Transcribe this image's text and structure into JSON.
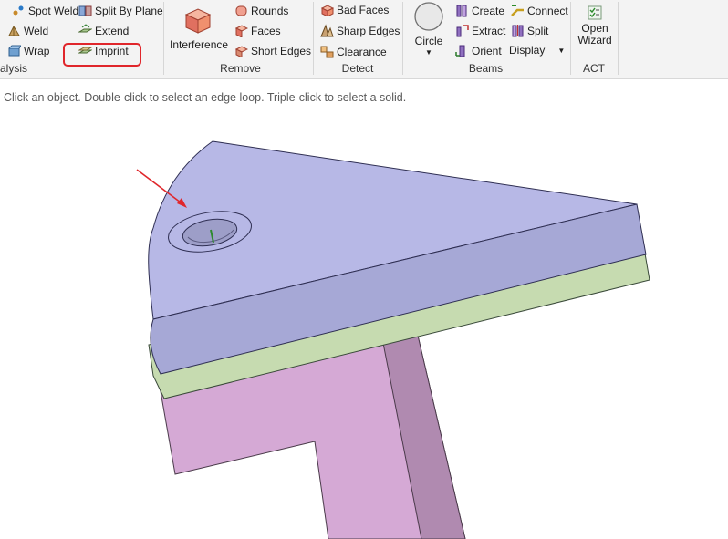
{
  "ribbon": {
    "analysis": {
      "spot_weld": "Spot Weld",
      "weld": "Weld",
      "wrap": "Wrap",
      "split_by_plane": "Split By Plane",
      "extend": "Extend",
      "imprint": "Imprint",
      "group_label": "alysis"
    },
    "remove": {
      "interference": "Interference",
      "rounds": "Rounds",
      "faces": "Faces",
      "short_edges": "Short Edges",
      "group_label": "Remove"
    },
    "detect": {
      "bad_faces": "Bad Faces",
      "sharp_edges": "Sharp Edges",
      "clearance": "Clearance",
      "group_label": "Detect"
    },
    "beams": {
      "circle": "Circle",
      "create": "Create",
      "extract": "Extract",
      "orient": "Orient",
      "connect": "Connect",
      "split": "Split",
      "display": "Display",
      "group_label": "Beams"
    },
    "act": {
      "open_line1": "Open",
      "open_line2": "Wizard",
      "group_label": "ACT"
    }
  },
  "status_text": "Click an object. Double-click to select an edge loop. Triple-click to select a solid.",
  "colors": {
    "top_plate": "#b7b8e6",
    "top_plate_side": "#a6a8d6",
    "mid_plate": "#c6dbb0",
    "bottom_part": "#d5a9d5",
    "bottom_part_side": "#b08ab0",
    "highlight_box": "#e0262b",
    "arrow": "#e0262b"
  }
}
